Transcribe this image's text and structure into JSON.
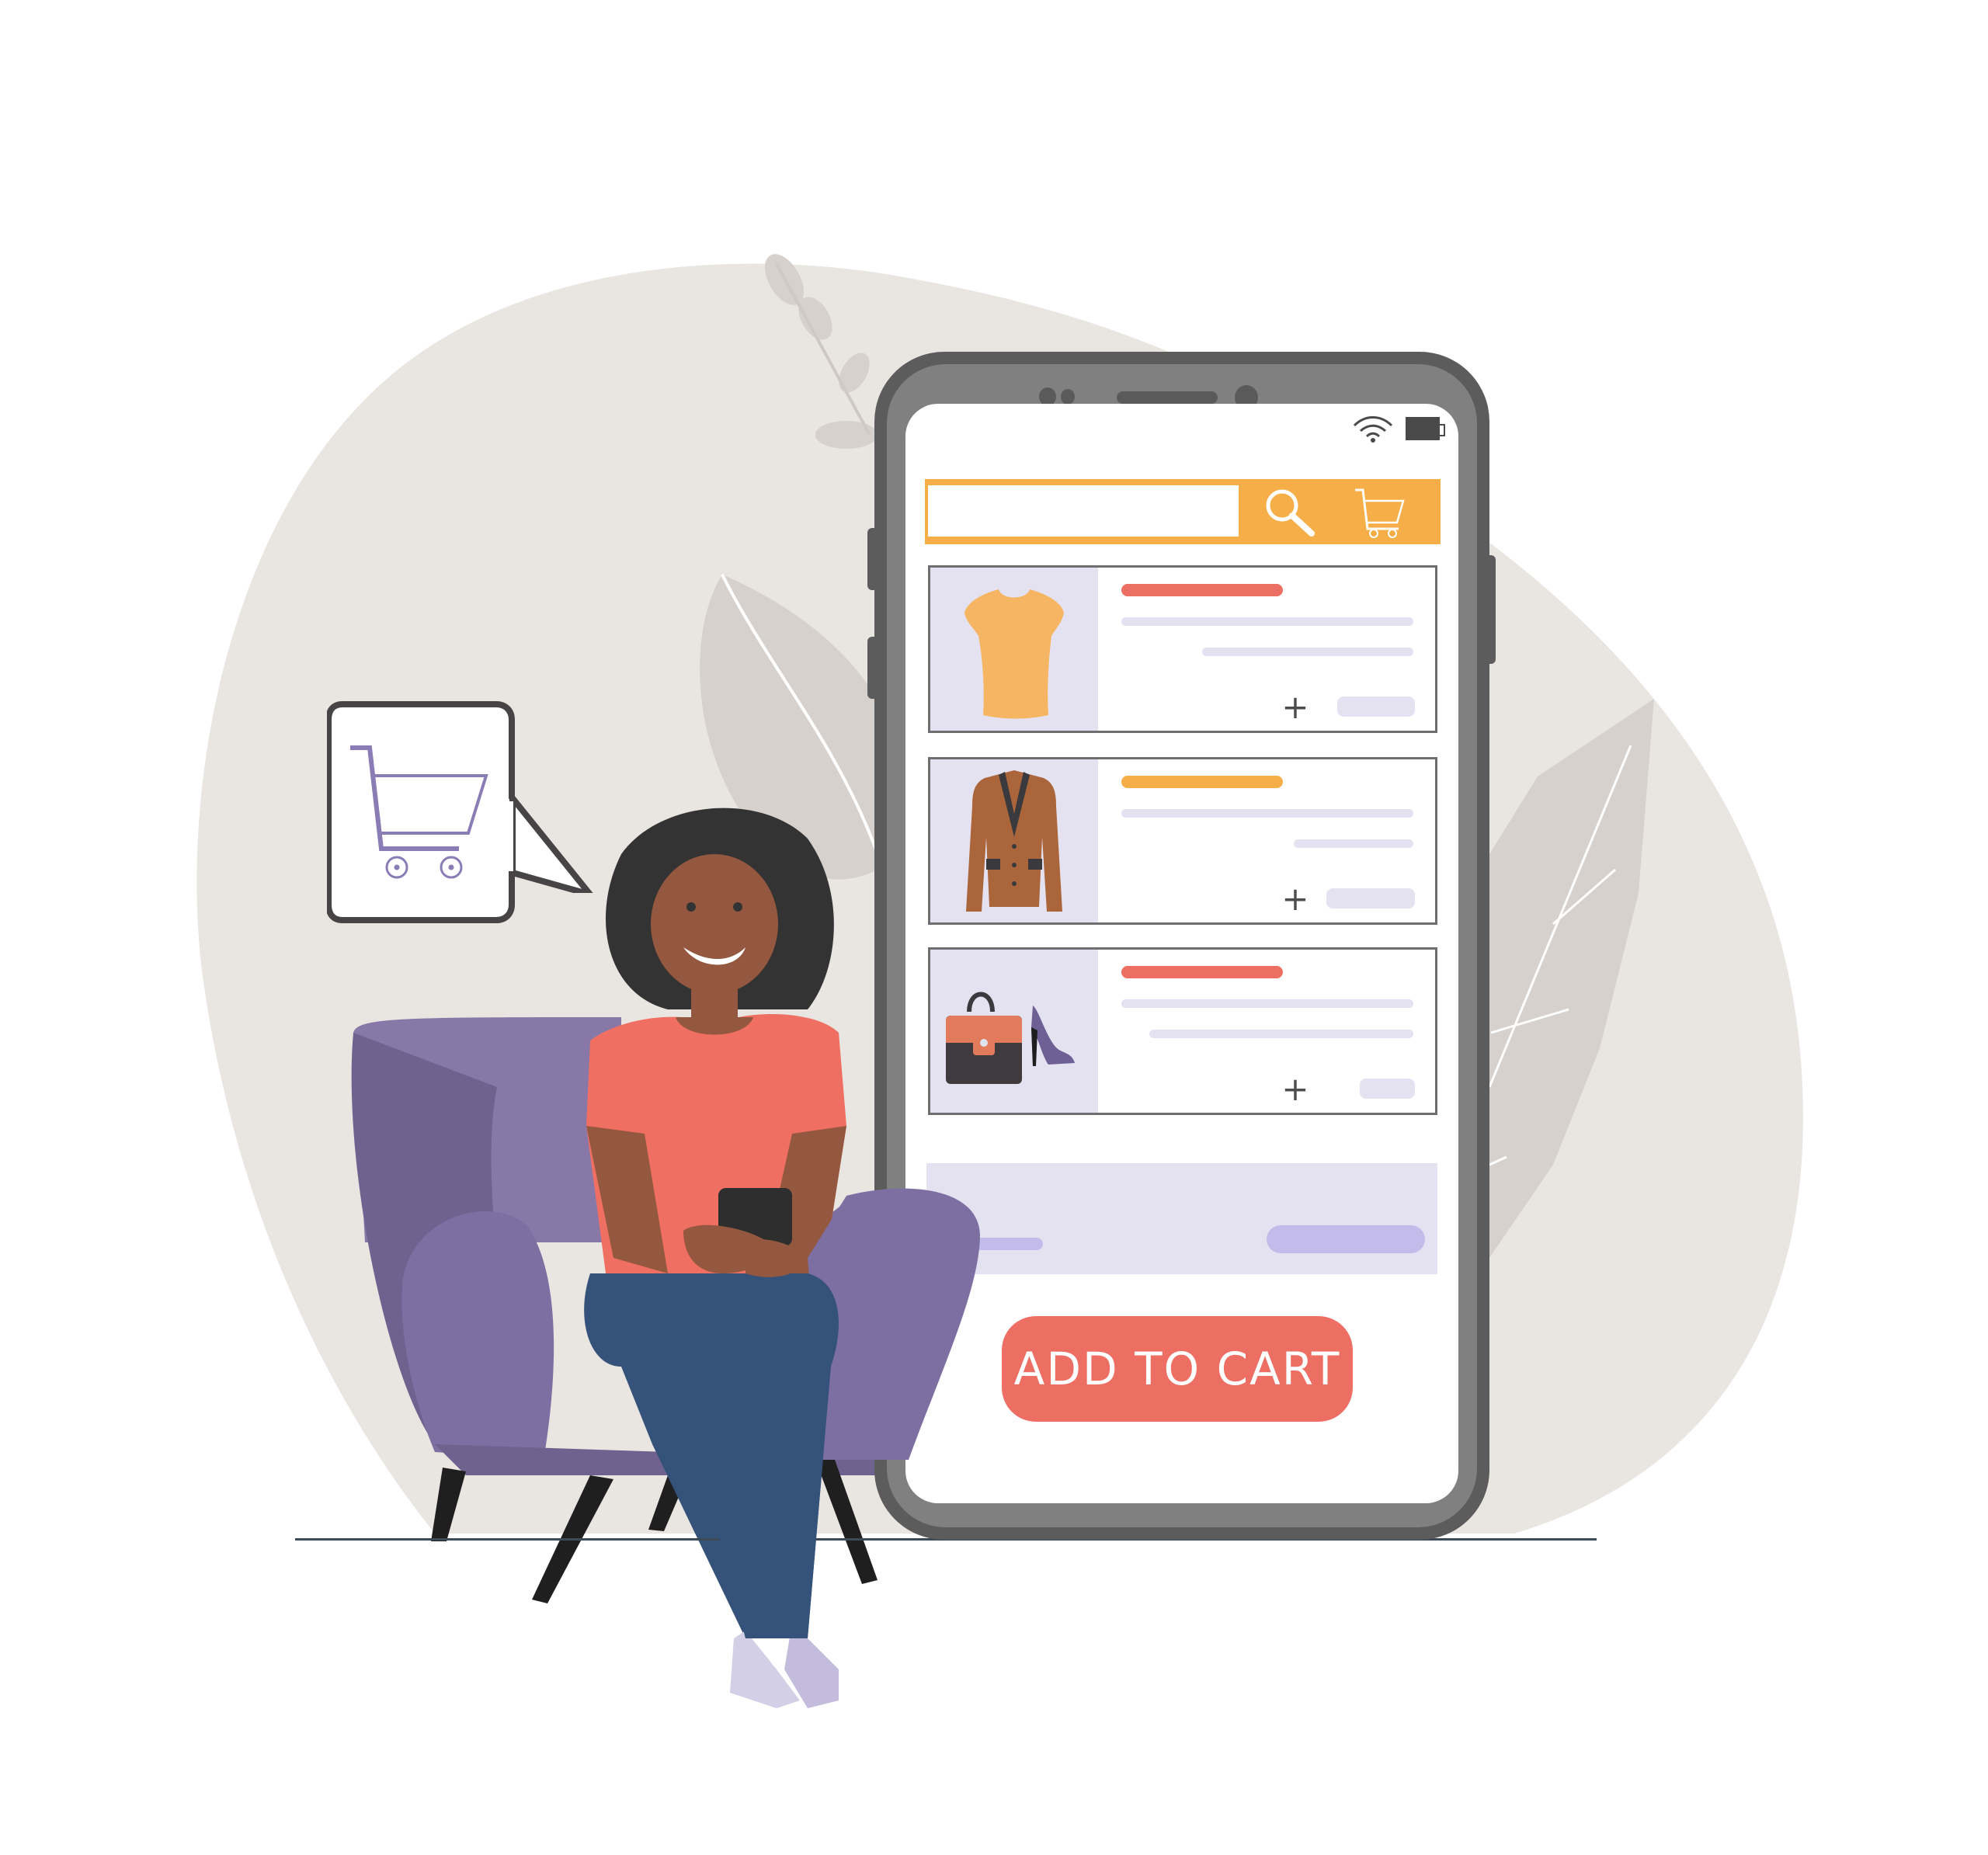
{
  "colors": {
    "accent_orange": "#f6ae48",
    "accent_coral": "#ed6f63",
    "lavender": "#e4e2f1",
    "lavender_dark": "#c3bbe9",
    "phone_frame": "#5c5c5c",
    "chair": "#7e6fa3",
    "background_blob": "#e9e5e0"
  },
  "status_bar": {
    "wifi_icon": "wifi-icon",
    "battery_icon": "battery-icon"
  },
  "search": {
    "value": "",
    "placeholder": "",
    "search_icon": "magnifier-icon",
    "cart_icon": "shopping-cart-icon"
  },
  "products": [
    {
      "name": "t-shirt",
      "icon": "t-shirt-icon",
      "title_color": "#ed6f63",
      "add_label": "+"
    },
    {
      "name": "jacket",
      "icon": "jacket-icon",
      "title_color": "#f6ae48",
      "add_label": "+"
    },
    {
      "name": "bag-and-heels",
      "icon": "handbag-icon",
      "title_color": "#ed6f63",
      "add_label": "+"
    }
  ],
  "cta": {
    "label": "ADD TO CART"
  },
  "speech_bubble": {
    "icon": "shopping-cart-icon"
  }
}
